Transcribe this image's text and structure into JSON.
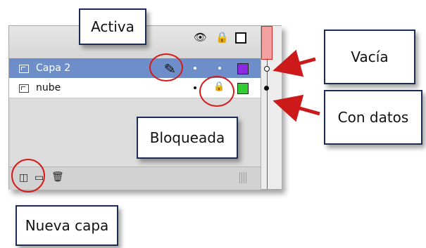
{
  "panel": {
    "layers": [
      {
        "name": "Capa 2",
        "state": "active",
        "color": "#8a2be2",
        "keyframe": "empty"
      },
      {
        "name": "nube",
        "state": "locked",
        "color": "#33cc33",
        "keyframe": "filled"
      }
    ],
    "header_icons": [
      "eye-icon",
      "lock-icon",
      "outline-square-icon"
    ],
    "footer_icons": [
      "new-layer-icon",
      "folder-icon",
      "trash-icon"
    ],
    "accent_color": "#6d8ec9",
    "playhead_color": "#e03030"
  },
  "callouts": {
    "activa": "Activa",
    "vacia": "Vacía",
    "con_datos": "Con datos",
    "bloqueada": "Bloqueada",
    "nueva_capa": "Nueva capa"
  }
}
